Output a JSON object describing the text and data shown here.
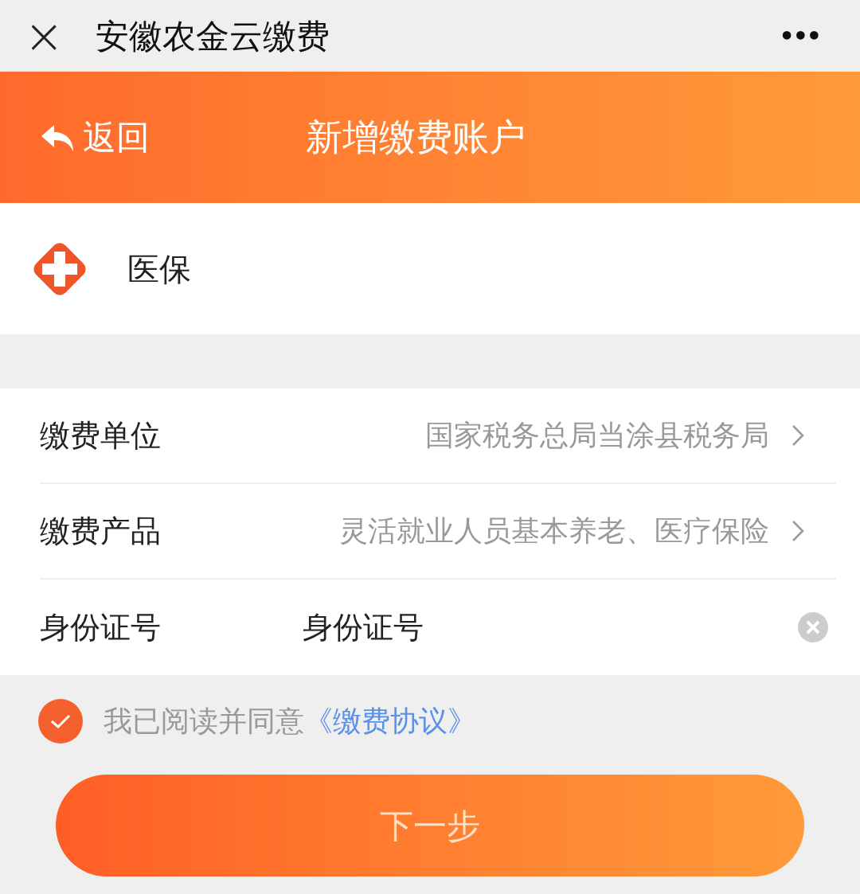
{
  "top_bar": {
    "close": "×",
    "title": "安徽农金云缴费",
    "more": "•••"
  },
  "header": {
    "back": "返回",
    "title": "新增缴费账户"
  },
  "category": {
    "label": "医保"
  },
  "form": {
    "rows": [
      {
        "kind": "select",
        "label": "缴费单位",
        "value": "国家税务总局当涂县税务局"
      },
      {
        "kind": "select",
        "label": "缴费产品",
        "value": "灵活就业人员基本养老、医疗保险"
      },
      {
        "kind": "input",
        "label": "身份证号",
        "value": "身份证号"
      }
    ]
  },
  "agreement": {
    "checked": true,
    "text": "我已阅读并同意",
    "link": "《缴费协议》"
  },
  "next_button": "下一步"
}
